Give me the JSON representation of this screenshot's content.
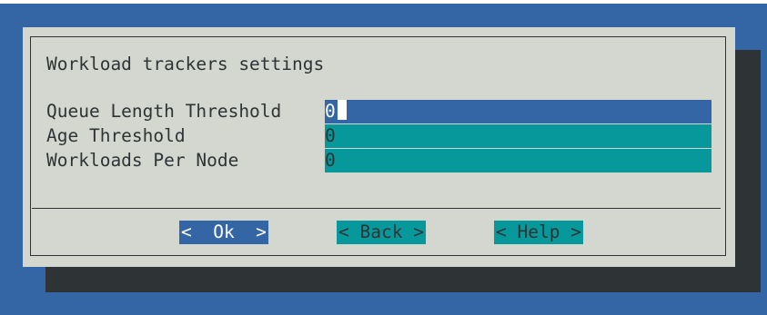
{
  "dialog": {
    "title": "Workload trackers settings"
  },
  "fields": [
    {
      "label": "Queue Length Threshold",
      "value": "0",
      "active": true
    },
    {
      "label": "Age Threshold",
      "value": "0",
      "active": false
    },
    {
      "label": "Workloads Per Node",
      "value": "0",
      "active": false
    }
  ],
  "buttons": {
    "ok": "<  Ok  >",
    "back": "< Back >",
    "help": "< Help >"
  },
  "colors": {
    "background": "#3465a4",
    "dialog": "#d3d7cf",
    "shadow": "#2e3436",
    "field": "#06989a",
    "active_field": "#3465a4"
  }
}
